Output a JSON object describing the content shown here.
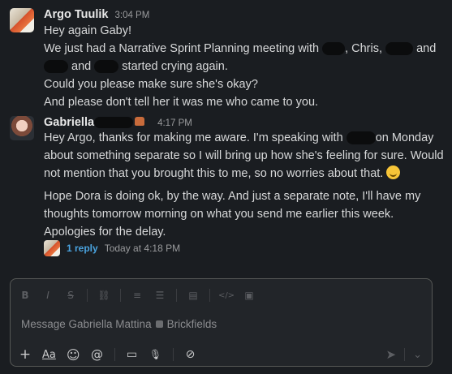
{
  "messages": [
    {
      "author": "Argo Tuulik",
      "time": "3:04 PM",
      "lines": [
        "Hey again Gaby!",
        "We just had a Narrative Sprint Planning meeting with",
        "Could you please make sure she's okay?",
        "And please don't tell her it was me who came to you."
      ],
      "line2_mid": ", Chris,",
      "line2_end": "and",
      "line3_mid": "and",
      "line3_end": "started crying again."
    },
    {
      "author": "Gabriella",
      "time": "4:17 PM",
      "lines": [
        "Hey Argo, thanks for making me aware. I'm speaking with",
        "about something separate so I will bring up how she's feeling for sure. Would",
        "not mention that you brought this to me, so no worries about that.",
        "Hope Dora is doing ok, by the way. And just a separate note, I'll have my",
        "thoughts tomorrow morning on what you send me earlier this week.",
        "Apologies for the delay."
      ],
      "line1_end": "on Monday"
    }
  ],
  "thread": {
    "replies": "1 reply",
    "last_reply": "Today at 4:18 PM"
  },
  "composer": {
    "placeholder_prefix": "Message Gabriella Mattina",
    "placeholder_org": "Brickfields",
    "format_icons": [
      "bold-icon",
      "italic-icon",
      "strikethrough-icon",
      "link-icon",
      "ordered-list-icon",
      "bulleted-list-icon",
      "blockquote-icon",
      "code-icon",
      "code-block-icon"
    ],
    "format_glyphs": [
      "B",
      "I",
      "S",
      "⛓",
      "≡",
      "☰",
      "▤",
      "</>",
      "▣"
    ],
    "bottom_icons": [
      "plus-icon",
      "formatting-icon",
      "emoji-icon",
      "mention-icon",
      "video-icon",
      "microphone-icon",
      "slash-command-icon"
    ],
    "bottom_glyphs": [
      "+",
      "Aa",
      "☺",
      "@",
      "▭",
      "🎙",
      "⊘"
    ],
    "send_glyph": "➤",
    "send_options_glyph": "⌄"
  },
  "colors": {
    "background": "#1a1d21",
    "link": "#4aa3df",
    "composer_border": "#565856"
  }
}
